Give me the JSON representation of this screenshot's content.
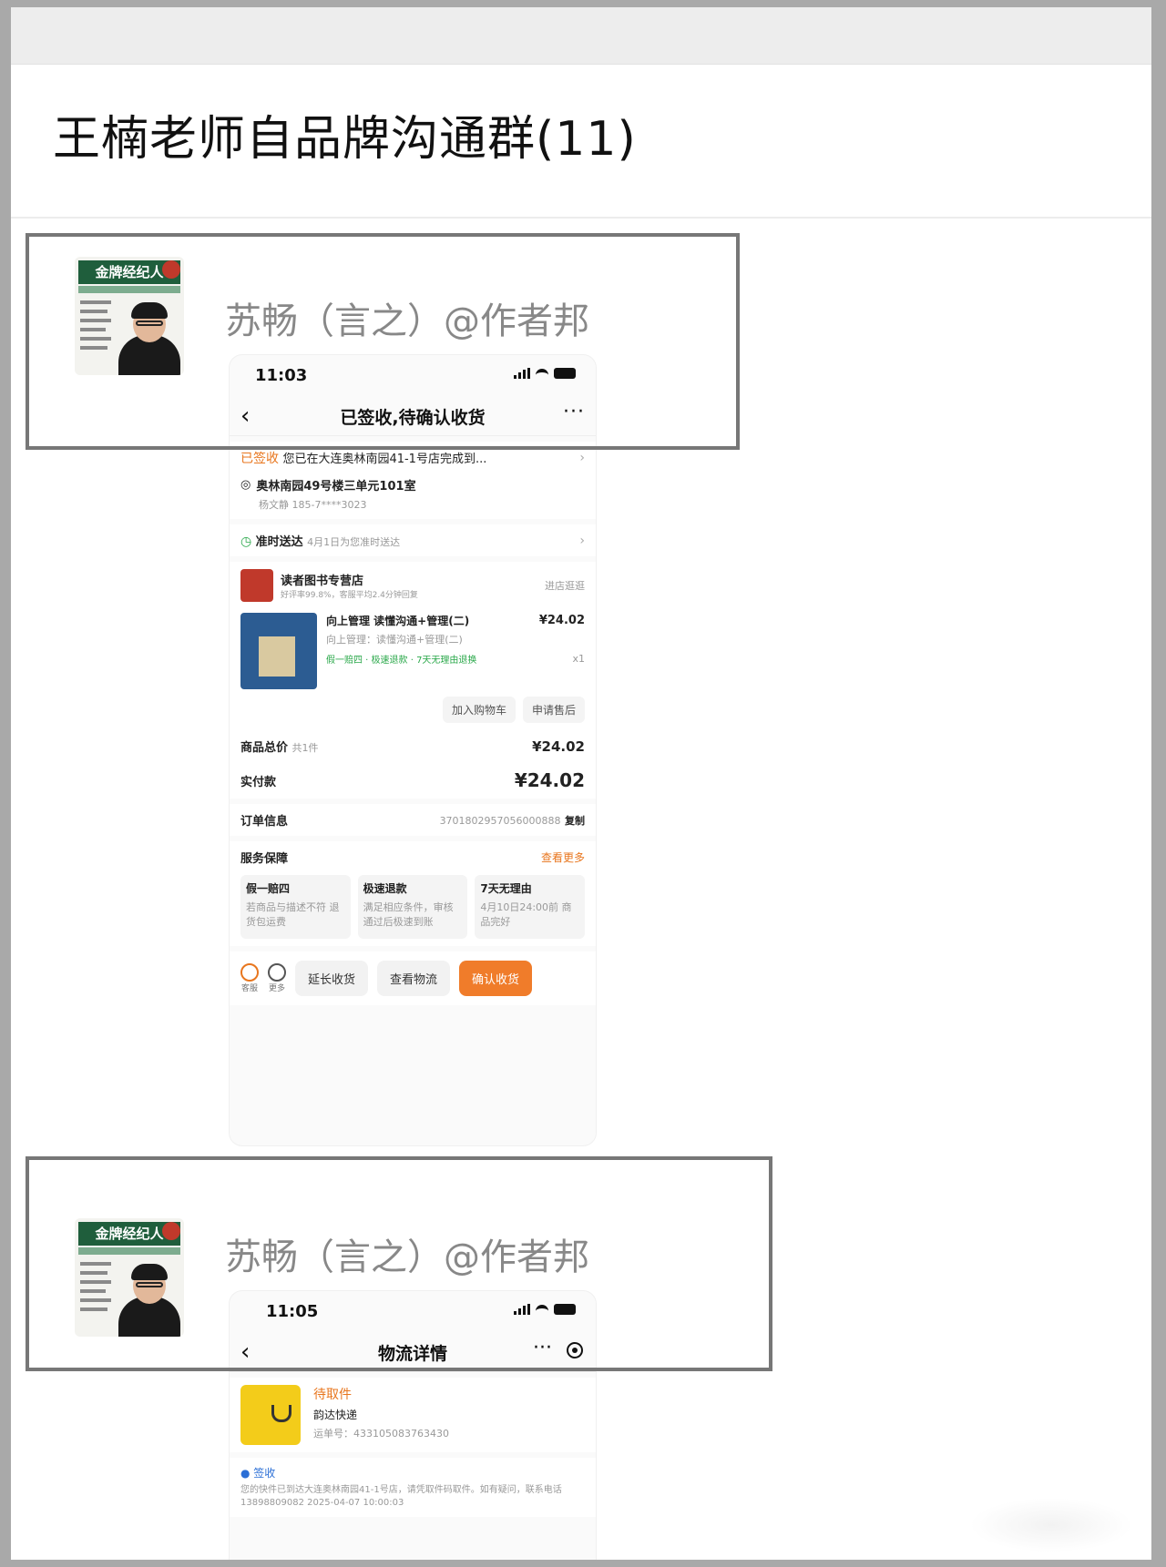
{
  "chat": {
    "title": "王楠老师自品牌沟通群(11)"
  },
  "messages": [
    {
      "sender": "苏畅（言之）@作者邦",
      "avatar": {
        "magazine_title": "金牌经纪人"
      },
      "screenshot": {
        "status_time": "11:03",
        "nav_title": "已签收,待确认收货",
        "delivery": {
          "status_label": "已签收",
          "status_text": "您已在大连奥林南园41-1号店完成到...",
          "address": "奥林南园49号楼三单元101室",
          "contact": "杨文静 185-7****3023"
        },
        "ontime": {
          "label": "准时送达",
          "text": "4月1日为您准时送达"
        },
        "shop": {
          "name": "读者图书专营店",
          "sub": "好评率99.8%，客服平均2.4分钟回复",
          "link": "进店逛逛"
        },
        "product": {
          "title": "向上管理 读懂沟通+管理(二)",
          "price": "¥24.02",
          "subtitle": "向上管理：读懂沟通+管理(二)",
          "tags": "假一赔四 · 极速退款 · 7天无理由退换",
          "qty": "x1",
          "btn_cart": "加入购物车",
          "btn_refund": "申请售后"
        },
        "totals": {
          "goods_label": "商品总价",
          "goods_count": "共1件",
          "goods_value": "¥24.02",
          "paid_label": "实付款",
          "paid_value": "¥24.02"
        },
        "order": {
          "label": "订单信息",
          "number": "3701802957056000888",
          "copy": "复制"
        },
        "service": {
          "label": "服务保障",
          "more": "查看更多",
          "cards": [
            {
              "title": "假一赔四",
              "text": "若商品与描述不符 退货包运费"
            },
            {
              "title": "极速退款",
              "text": "满足相应条件，审核通过后极速到账"
            },
            {
              "title": "7天无理由",
              "text": "4月10日24:00前 商品完好"
            }
          ]
        },
        "bottom": {
          "icon1": "客服",
          "icon2": "更多",
          "btn_extend": "延长收货",
          "btn_logistics": "查看物流",
          "btn_confirm": "确认收货"
        }
      }
    },
    {
      "sender": "苏畅（言之）@作者邦",
      "avatar": {
        "magazine_title": "金牌经纪人"
      },
      "screenshot": {
        "status_time": "11:05",
        "nav_title": "物流详情",
        "courier": {
          "status": "待取件",
          "name": "韵达快递",
          "tracking": "运单号：433105083763430"
        },
        "track": {
          "label": "签收",
          "text": "您的快件已到达大连奥林南园41-1号店，请凭取件码取件。如有疑问，联系电话13898809082 2025-04-07 10:00:03"
        }
      }
    }
  ]
}
